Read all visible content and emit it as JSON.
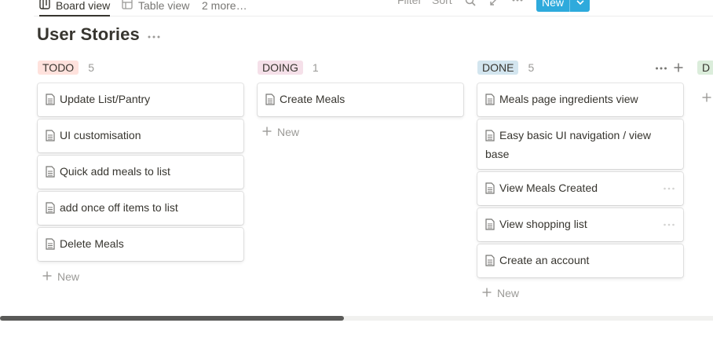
{
  "viewbar": {
    "tabs": [
      {
        "label": "Board view",
        "icon": "board-icon",
        "active": true
      },
      {
        "label": "Table view",
        "icon": "table-icon",
        "active": false
      },
      {
        "label": "2 more…",
        "icon": null,
        "active": false
      }
    ],
    "filter_label": "Filter",
    "sort_label": "Sort",
    "new_label": "New"
  },
  "title": "User Stories",
  "colors": {
    "todo_tag": "#ffe2dd",
    "doing_tag": "#f5e0e9",
    "done_tag": "#d3e5ef",
    "partial_tag": "#dbeddb",
    "new_button": "#2eaadc"
  },
  "columns": [
    {
      "name": "TODO",
      "count": "5",
      "cards": [
        {
          "title": "Update List/Pantry"
        },
        {
          "title": "UI customisation"
        },
        {
          "title": "Quick add meals to list"
        },
        {
          "title": "add once off items to list"
        },
        {
          "title": "Delete Meals"
        }
      ],
      "new_label": "New"
    },
    {
      "name": "DOING",
      "count": "1",
      "cards": [
        {
          "title": "Create Meals"
        }
      ],
      "new_label": "New"
    },
    {
      "name": "DONE",
      "count": "5",
      "cards": [
        {
          "title": "Meals page ingredients view"
        },
        {
          "title": "Easy basic UI navigation / view base"
        },
        {
          "title": "View Meals Created"
        },
        {
          "title": "View shopping list"
        },
        {
          "title": "Create an account"
        }
      ],
      "new_label": "New"
    },
    {
      "name": "D",
      "count": "",
      "cards": [],
      "new_label": ""
    }
  ]
}
